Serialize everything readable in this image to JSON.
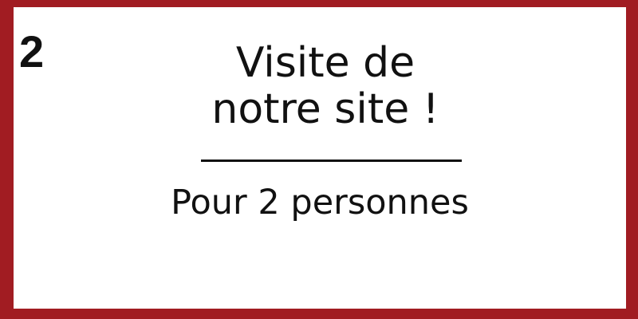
{
  "card": {
    "number": "2",
    "title_line_1": "Visite de",
    "title_line_2": "notre site !",
    "subtitle": "Pour 2 personnes",
    "colors": {
      "border": "#a11c22",
      "background": "#ffffff",
      "text": "#111111"
    }
  }
}
